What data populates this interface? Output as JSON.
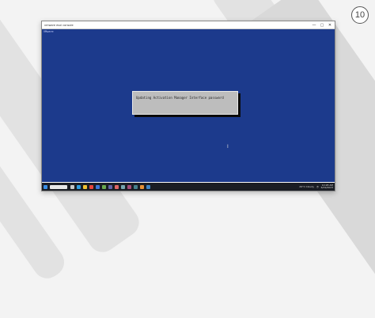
{
  "slide": {
    "number": "10"
  },
  "window": {
    "title": "vmware esxi console",
    "controls": {
      "minimize": "—",
      "maximize": "▢",
      "close": "✕"
    }
  },
  "console": {
    "header": "VMware",
    "dialog_message": "Updating Activation Manager Interface password"
  },
  "taskbar": {
    "icons": [
      {
        "name": "start-icon",
        "color": "#3a8ee6"
      },
      {
        "name": "task-view-icon",
        "color": "#c8c8c8"
      },
      {
        "name": "edge-icon",
        "color": "#2f9de0"
      },
      {
        "name": "explorer-icon",
        "color": "#f1c232"
      },
      {
        "name": "chrome-icon",
        "color": "#e8453c"
      },
      {
        "name": "mail-icon",
        "color": "#3b78d8"
      },
      {
        "name": "terminal-icon",
        "color": "#6aa84f"
      },
      {
        "name": "teams-icon",
        "color": "#6264a7"
      },
      {
        "name": "app-icon-1",
        "color": "#e06666"
      },
      {
        "name": "app-icon-2",
        "color": "#76a5af"
      },
      {
        "name": "app-icon-3",
        "color": "#a64d79"
      },
      {
        "name": "app-icon-4",
        "color": "#45818e"
      },
      {
        "name": "app-icon-5",
        "color": "#e69138"
      },
      {
        "name": "app-icon-6",
        "color": "#3d85c6"
      }
    ],
    "weather": "29°C Cloudy",
    "time": "10:28 AM",
    "date": "6/19/2023"
  }
}
